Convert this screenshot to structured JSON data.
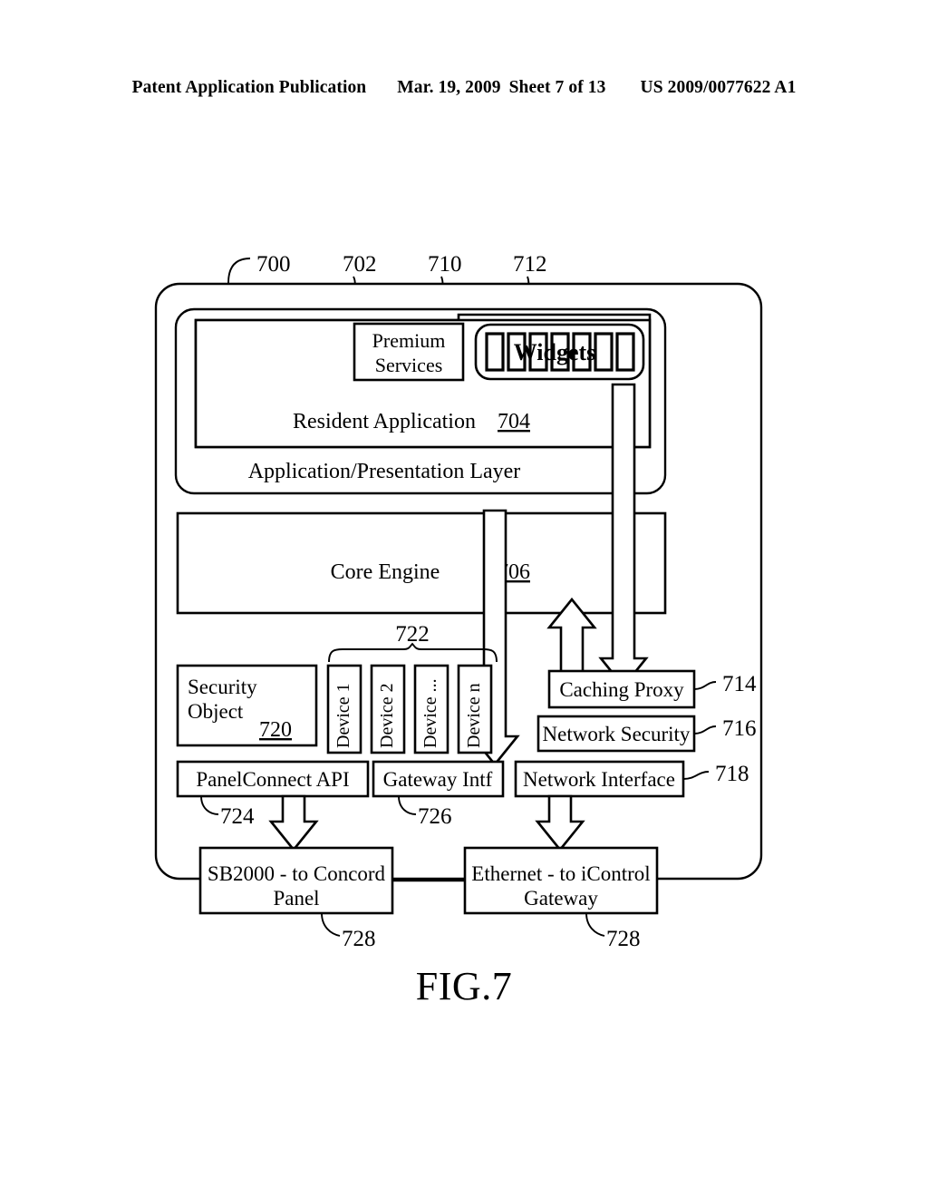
{
  "header": {
    "publication": "Patent Application Publication",
    "date": "Mar. 19, 2009",
    "sheet": "Sheet 7 of 13",
    "patent_number": "US 2009/0077622 A1"
  },
  "figure": {
    "caption": "FIG.7",
    "reference_numbers": {
      "outer_system": "700",
      "app_presentation_layer": "702",
      "premium_services": "710",
      "widgets": "712",
      "resident_application": "704",
      "core_engine": "706",
      "caching_proxy": "714",
      "network_security": "716",
      "network_interface": "718",
      "security_object": "720",
      "devices_brace": "722",
      "panelconnect_api": "724",
      "gateway_intf": "726",
      "sb2000_panel": "728",
      "ethernet_gateway": "728"
    },
    "blocks": {
      "premium_services": {
        "line1": "Premium",
        "line2": "Services"
      },
      "widgets": {
        "label": "Widgets",
        "cell_count": 7
      },
      "resident_application": {
        "label": "Resident Application"
      },
      "app_presentation_layer": {
        "label": "Application/Presentation Layer"
      },
      "core_engine": {
        "label": "Core Engine"
      },
      "security_object": {
        "line1": "Security",
        "line2": "Object"
      },
      "devices": [
        {
          "label": "Device 1"
        },
        {
          "label": "Device 2"
        },
        {
          "label": "Device ..."
        },
        {
          "label": "Device n"
        }
      ],
      "caching_proxy": {
        "label": "Caching Proxy"
      },
      "network_security": {
        "label": "Network Security"
      },
      "network_interface": {
        "label": "Network Interface"
      },
      "panelconnect_api": {
        "label": "PanelConnect API"
      },
      "gateway_intf": {
        "label": "Gateway Intf"
      },
      "sb2000_panel": {
        "line1": "SB2000 - to Concord",
        "line2": "Panel"
      },
      "ethernet_gateway": {
        "line1": "Ethernet - to iControl",
        "line2": "Gateway"
      }
    }
  },
  "colors": {
    "ink": "#000000",
    "paper": "#ffffff"
  }
}
